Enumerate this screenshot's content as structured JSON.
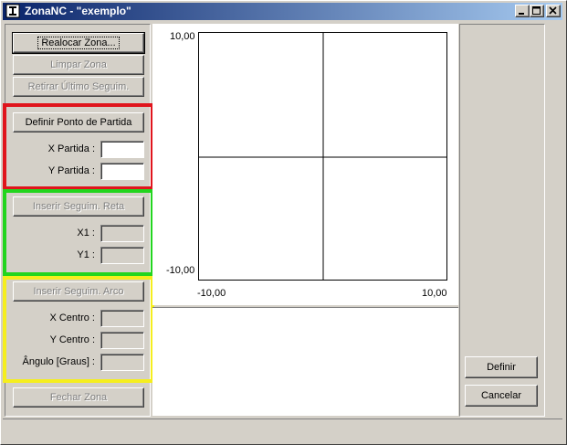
{
  "window": {
    "title": "ZonaNC - \"exemplo\""
  },
  "left_panel": {
    "realocar_label": "Realocar Zona...",
    "limpar_label": "Limpar Zona",
    "retirar_label": "Retirar Último Seguim.",
    "partida": {
      "button_label": "Definir Ponto de Partida",
      "x_label": "X Partida :",
      "x_value": "",
      "y_label": "Y Partida :",
      "y_value": "",
      "frame_color": "#e0141c"
    },
    "reta": {
      "button_label": "Inserir Seguim. Reta",
      "x1_label": "X1 :",
      "x1_value": "",
      "y1_label": "Y1 :",
      "y1_value": "",
      "frame_color": "#22d51e"
    },
    "arco": {
      "button_label": "Inserir Seguim. Arco",
      "xc_label": "X Centro :",
      "xc_value": "",
      "yc_label": "Y Centro :",
      "yc_value": "",
      "ang_label": "Ângulo [Graus] :",
      "ang_value": "",
      "frame_color": "#f5ee1e"
    },
    "fechar_label": "Fechar Zona"
  },
  "plot": {
    "y_max_label": "10,00",
    "y_min_label": "-10,00",
    "x_min_label": "-10,00",
    "x_max_label": "10,00"
  },
  "right_panel": {
    "definir_label": "Definir",
    "cancelar_label": "Cancelar"
  }
}
